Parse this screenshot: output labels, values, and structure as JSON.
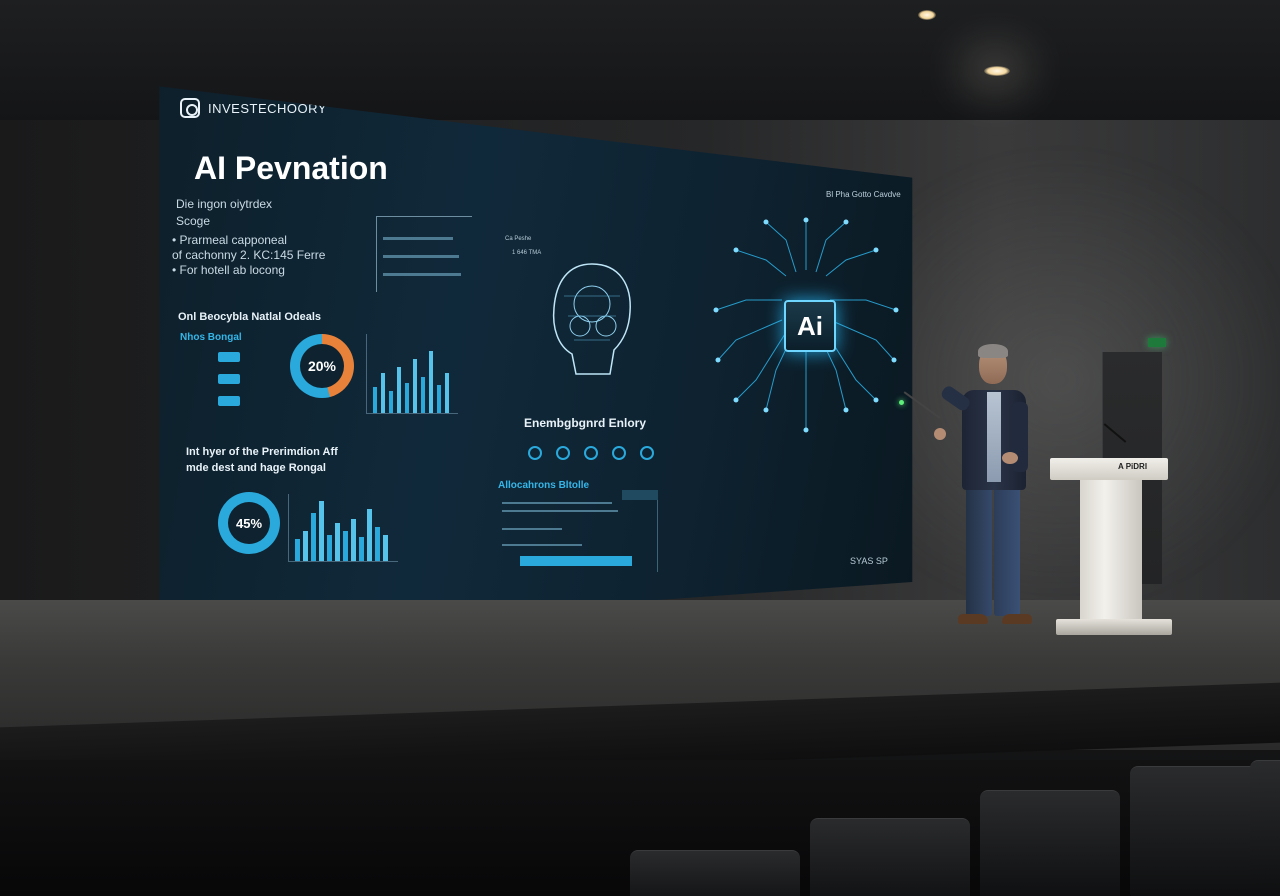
{
  "screen": {
    "brand": "INVESTECHOORY",
    "title": "AI Pevnation",
    "subtitle_lines": [
      "Die ingon oiytrdex",
      "Scoge"
    ],
    "bullets": [
      "• Prarmeal capponeal",
      "of cachonny 2. KC:145 Ferre",
      "• For hotell ab locong"
    ],
    "top_right_label": "Bl Pha Gotto Cavdve",
    "ai_chip_label": "Ai",
    "left_mid_title": "Onl Beocybla Natlal Odeals",
    "left_mid_accent": "Nhos Bongal",
    "left_mid_donut_value": "20%",
    "left_bottom_title": "Int hyer of the Prerimdion Aff",
    "left_bottom_subtitle": "mde dest and hage Rongal",
    "left_bottom_donut_value": "45%",
    "head_labels": [
      "Ca Peshe",
      "1 646 TMA"
    ],
    "center_title": "Enembgbgnrd Enlory",
    "center_bottom_title": "Allocahrons Bltolle",
    "bottom_right_label": "SYAS SP"
  },
  "colors": {
    "accent_blue": "#35b6e8",
    "accent_orange": "#e8823a",
    "screen_bg": "#10293a",
    "podium": "#f1efe9"
  },
  "podium": {
    "label": "A PiDRI"
  }
}
